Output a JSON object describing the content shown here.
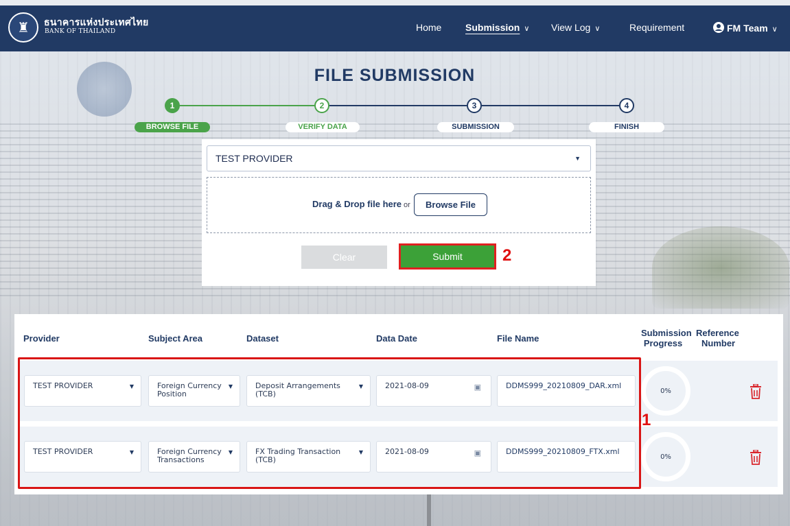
{
  "nav": {
    "brand_thai": "ธนาคารแห่งประเทศไทย",
    "brand_en": "BANK OF THAILAND",
    "items": [
      {
        "label": "Home",
        "has_dropdown": false,
        "active": false
      },
      {
        "label": "Submission",
        "has_dropdown": true,
        "active": true
      },
      {
        "label": "View Log",
        "has_dropdown": true,
        "active": false
      },
      {
        "label": "Requirement",
        "has_dropdown": false,
        "active": false
      }
    ],
    "user_label": "FM Team",
    "user_icon": "user-circle-icon",
    "chevron": "∨"
  },
  "page": {
    "title": "FILE SUBMISSION"
  },
  "stepper": {
    "steps": [
      {
        "number": "1",
        "label": "BROWSE FILE",
        "state": "active"
      },
      {
        "number": "2",
        "label": "VERIFY DATA",
        "state": "next"
      },
      {
        "number": "3",
        "label": "SUBMISSION",
        "state": "pending"
      },
      {
        "number": "4",
        "label": "FINISH",
        "state": "pending"
      }
    ]
  },
  "upload": {
    "provider_value": "TEST PROVIDER",
    "drop_text": "Drag & Drop file here",
    "drop_or": "or",
    "browse_label": "Browse File",
    "clear_label": "Clear",
    "submit_label": "Submit"
  },
  "annotations": {
    "label_1": "1",
    "label_2": "2"
  },
  "table": {
    "headers": {
      "provider": "Provider",
      "subject_area": "Subject Area",
      "dataset": "Dataset",
      "data_date": "Data Date",
      "file_name": "File Name",
      "progress_line1": "Submission",
      "progress_line2": "Progress",
      "reference_line1": "Reference",
      "reference_line2": "Number"
    },
    "rows": [
      {
        "provider": "TEST PROVIDER",
        "subject_area": "Foreign Currency Position",
        "dataset": "Deposit Arrangements (TCB)",
        "data_date": "2021-08-09",
        "file_name": "DDMS999_20210809_DAR.xml",
        "progress": "0%"
      },
      {
        "provider": "TEST PROVIDER",
        "subject_area": "Foreign Currency Transactions",
        "dataset": "FX Trading Transaction (TCB)",
        "data_date": "2021-08-09",
        "file_name": "DDMS999_20210809_FTX.xml",
        "progress": "0%"
      }
    ]
  },
  "colors": {
    "navy": "#213a64",
    "green": "#3ca138",
    "step_green": "#4aa34a",
    "highlight_red": "#e02020",
    "delete_red": "#d9262c"
  }
}
